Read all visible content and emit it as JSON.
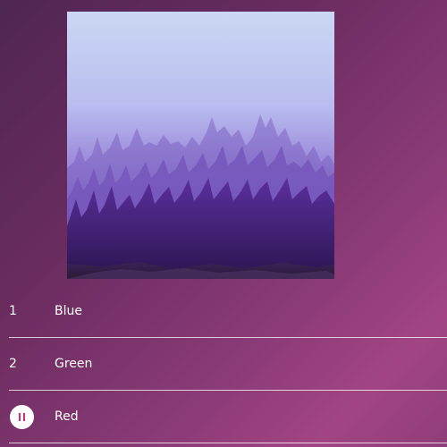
{
  "album_art": {
    "icon": "forest-fog-artwork"
  },
  "tracks": [
    {
      "number": "1",
      "title": "Blue",
      "state": "idle"
    },
    {
      "number": "2",
      "title": "Green",
      "state": "idle"
    },
    {
      "number": "",
      "title": "Red",
      "state": "playing",
      "control_icon": "pause-icon"
    }
  ],
  "colors": {
    "accent": "#d62b6e",
    "text": "#ffffff"
  }
}
